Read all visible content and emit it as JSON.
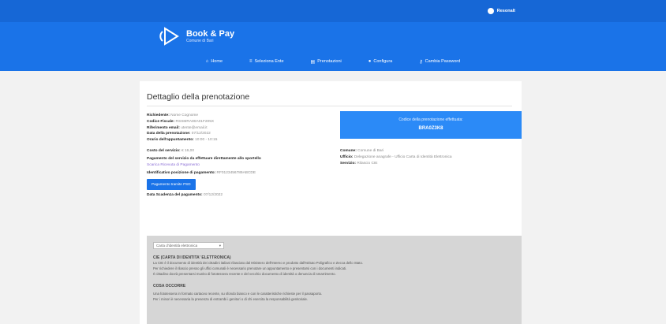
{
  "header": {
    "user_label": "Resonalt",
    "logo_title": "Book & Pay",
    "logo_subtitle": "Comune di Bari"
  },
  "nav": [
    {
      "icon": "home-icon",
      "glyph": "⌂",
      "label": "Home"
    },
    {
      "icon": "list-icon",
      "glyph": "≡",
      "label": "Seleziona Ente"
    },
    {
      "icon": "calendar-icon",
      "glyph": "▤",
      "label": "Prenotazioni"
    },
    {
      "icon": "user-icon",
      "glyph": "●",
      "label": "Configura"
    },
    {
      "icon": "key-icon",
      "glyph": "⚷",
      "label": "Cambia Password"
    }
  ],
  "page": {
    "title": "Dettaglio della prenotazione",
    "details": [
      {
        "label": "Richiedente:",
        "value": "Nome Cognome"
      },
      {
        "label": "Codice Fiscale:",
        "value": "RSSMRA80A01F205X"
      },
      {
        "label": "Riferimento email:",
        "value": "utente@email.it"
      },
      {
        "label": "Data della prenotazione:",
        "value": "07/12/2022"
      },
      {
        "label": "Orario dell'appuntamento:",
        "value": "10:00 - 10:15"
      }
    ],
    "cost_label": "Costo del servizio:",
    "cost_value": "€ 16,00",
    "payment_note": "Pagamento del servizio da effettuare direttamente allo sportello",
    "payment_link": "Scarica Ricevuta di Pagamento",
    "iuv_label": "Identificativo posizione di pagamento:",
    "iuv_value": "RF0123456789ABCDE",
    "pay_button": "Pagamento tramite PSD",
    "expiry_label": "Data Scadenza del pagamento:",
    "expiry_value": "07/12/2022"
  },
  "summary": {
    "line1": "Codice della prenotazione effettuata:",
    "code": "BRA0Z3K8"
  },
  "right_info": [
    {
      "label": "Comune:",
      "value": "Comune di Bari"
    },
    {
      "label": "Ufficio:",
      "value": "Delegazione anagrafe - Ufficio Carta di Identità Elettronica"
    },
    {
      "label": "Servizio:",
      "value": "Rilascio CIE"
    }
  ],
  "panel": {
    "select_value": "Carta d'identità elettronica",
    "h1": "CIE (CARTA DI IDENTITA' ELETTRONICA)",
    "p1": "La CIE è il documento di identità dei cittadini italiani rilasciato dal Ministero dell'Interno e prodotto dall'Istituto Poligrafico e Zecca dello Stato.",
    "p2": "Per richiedere il rilascio presso gli uffici comunali è necessario prenotare un appuntamento e presentarsi con i documenti indicati.",
    "p3": "Il cittadino dovrà presentarsi munito di fototessera recente e del vecchio documento di identità o denuncia di smarrimento.",
    "h2": "COSA OCCORRE",
    "p4": "Una fototessera in formato cartaceo recente, su sfondo bianco e con le caratteristiche richieste per il passaporto.",
    "p5": "Per i minori è necessaria la presenza di entrambi i genitori o di chi esercita la responsabilità genitoriale."
  }
}
